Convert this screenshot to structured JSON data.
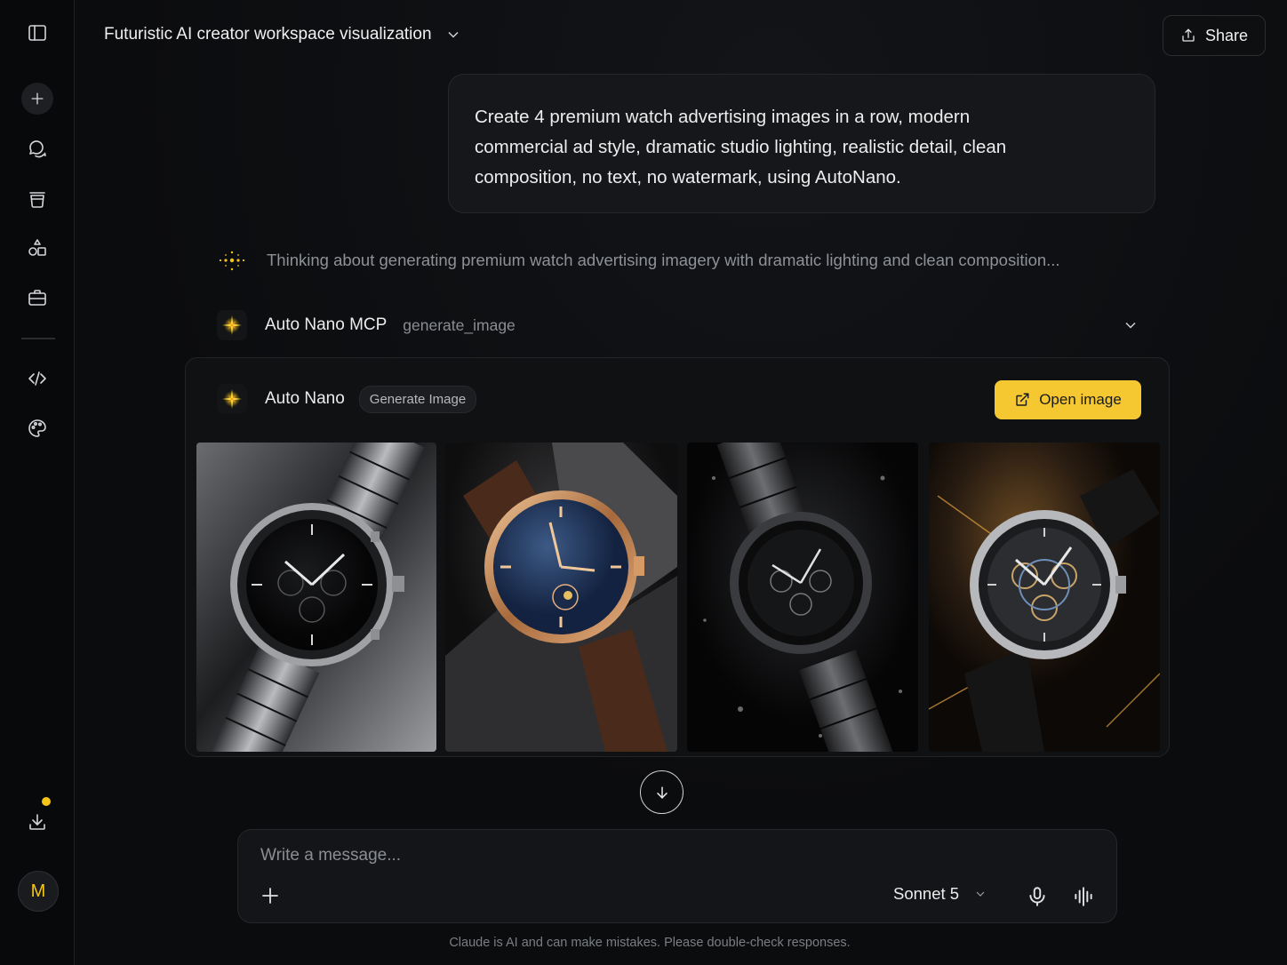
{
  "header": {
    "title": "Futuristic AI creator workspace visualization",
    "share_label": "Share"
  },
  "sidebar": {
    "items": [
      {
        "name": "panel-toggle-icon"
      },
      {
        "name": "new-chat-icon"
      },
      {
        "name": "chats-icon"
      },
      {
        "name": "projects-icon"
      },
      {
        "name": "artifacts-icon"
      },
      {
        "name": "briefcase-icon"
      },
      {
        "name": "code-icon"
      },
      {
        "name": "palette-icon"
      },
      {
        "name": "download-icon"
      }
    ],
    "avatar_initial": "M",
    "notification_color": "#f5c518"
  },
  "conversation": {
    "user_message": "Create 4 premium watch advertising images in a row, modern commercial ad style, dramatic studio lighting, realistic detail, clean composition, no text, no watermark, using AutoNano.",
    "thinking_text": "Thinking about generating premium watch advertising imagery with dramatic lighting and clean composition...",
    "tool_call": {
      "server": "Auto Nano MCP",
      "tool": "generate_image"
    },
    "result_card": {
      "name": "Auto Nano",
      "badge": "Generate Image",
      "open_label": "Open image",
      "images": [
        {
          "subject": "black dial chronograph on steel bracelet"
        },
        {
          "subject": "rose gold watch with blue dial on brown leather strap"
        },
        {
          "subject": "black steel chronograph on wet dark surface"
        },
        {
          "subject": "skeleton chronograph on leather strap with gold light"
        }
      ]
    }
  },
  "composer": {
    "placeholder": "Write a message...",
    "model": "Sonnet 5"
  },
  "disclaimer": "Claude is AI and can make mistakes. Please double-check responses.",
  "colors": {
    "accent": "#f5c832",
    "background": "#0b0c0e"
  }
}
